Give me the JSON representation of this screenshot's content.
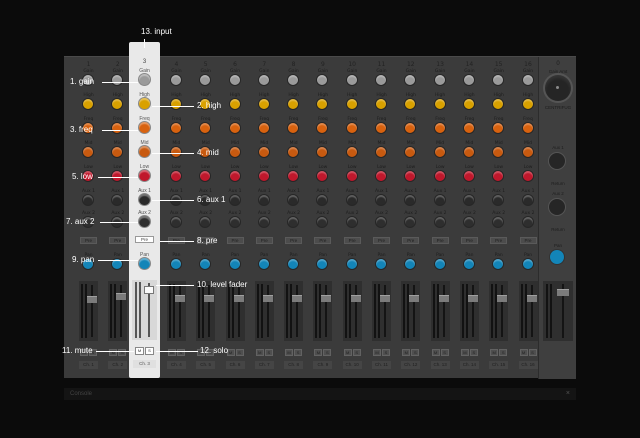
{
  "callouts": {
    "gain": "1. gain",
    "high": "2. high",
    "freq": "3. freq",
    "mid": "4. mid",
    "low": "5. low",
    "aux1": "6. aux 1",
    "aux2": "7. aux 2",
    "pre": "8. pre",
    "pan": "9. pan",
    "fader": "10. level fader",
    "mute": "11. mute",
    "solo": "12. solo",
    "input": "13. input"
  },
  "strip_labels": {
    "gain": "Gain",
    "high": "High",
    "freq": "Freq",
    "mid": "Mid",
    "low": "Low",
    "aux1": "Aux 1",
    "aux2": "Aux 2",
    "pre": "Pre",
    "pan": "Pan",
    "mute": "M",
    "solo": "S"
  },
  "channels": [
    {
      "number": "1",
      "name": "Ch. 1"
    },
    {
      "number": "2",
      "name": "Ch. 2"
    },
    {
      "number": "3",
      "name": "Ch. 3"
    },
    {
      "number": "4",
      "name": "Ch. 4"
    },
    {
      "number": "5",
      "name": "Ch. 5"
    },
    {
      "number": "6",
      "name": "Ch. 6"
    },
    {
      "number": "7",
      "name": "Ch. 7"
    },
    {
      "number": "8",
      "name": "Ch. 8"
    },
    {
      "number": "9",
      "name": "Ch. 9"
    },
    {
      "number": "10",
      "name": "Ch. 10"
    },
    {
      "number": "11",
      "name": "Ch. 11"
    },
    {
      "number": "12",
      "name": "Ch. 12"
    },
    {
      "number": "13",
      "name": "Ch. 13"
    },
    {
      "number": "14",
      "name": "Ch. 14"
    },
    {
      "number": "15",
      "name": "Ch. 15"
    },
    {
      "number": "16",
      "name": "Ch. 16"
    }
  ],
  "selected_channel": 3,
  "master": {
    "number": "0",
    "top_label": "Gain Amt",
    "device_label": "CENTRIFUG",
    "aux1_label": "Aux 1",
    "aux2_label": "Aux 2",
    "return_label": "Return",
    "pan_label": "Pan"
  },
  "footer": {
    "title": "Console",
    "close": "×"
  },
  "colors": {
    "gain": "#9a9a9a",
    "high": "#d9a100",
    "freq": "#d8620f",
    "mid": "#c85a10",
    "low": "#c0182c",
    "aux": "#2a2a2a",
    "pan": "#1385b8"
  }
}
